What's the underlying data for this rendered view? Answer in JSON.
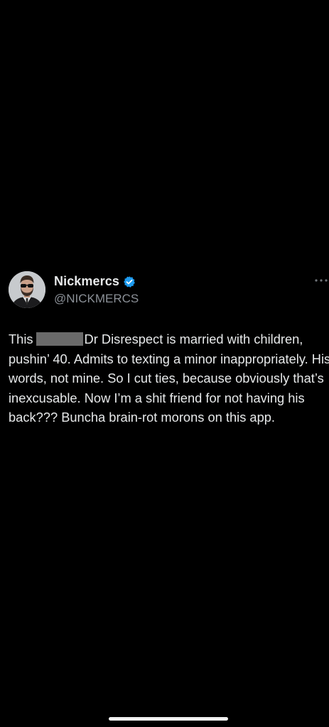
{
  "tweet": {
    "display_name": "Nickmercs",
    "handle": "@NICKMERCS",
    "verified": true,
    "text_before_redaction": "This",
    "text_after_redaction": "Dr Disrespect is married with children, pushin’ 40. Admits to texting a minor inappropriately. His words, not mine. So I cut ties, because obviously that’s inexcusable. Now I’m a shit friend for not having his back??? Buncha brain-rot morons on this app."
  },
  "icons": {
    "avatar": "profile-avatar",
    "verified": "verified-badge-icon",
    "more": "more-options-icon"
  },
  "colors": {
    "background": "#000000",
    "text": "#e7e9ea",
    "handle": "#8b9097",
    "verified": "#1d9bf0",
    "redaction": "#6a6a6a"
  }
}
